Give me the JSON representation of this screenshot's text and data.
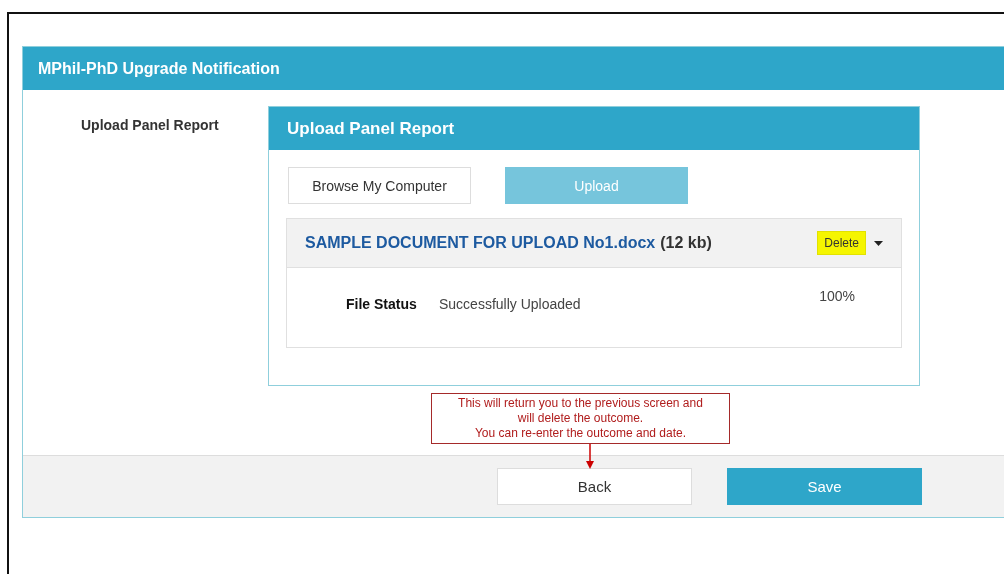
{
  "panel": {
    "title": "MPhil-PhD Upgrade Notification"
  },
  "field_label": "Upload Panel Report",
  "upload_card": {
    "title": "Upload Panel Report",
    "browse_button": "Browse My Computer",
    "upload_button": "Upload",
    "file": {
      "name": "SAMPLE DOCUMENT FOR UPLOAD No1.docx",
      "size": "(12 kb)",
      "delete_button": "Delete",
      "delete_highlighted": true,
      "status_label": "File Status",
      "status": "Successfully Uploaded",
      "percent": "100%"
    }
  },
  "annotation": {
    "lines": [
      "This will return you to the previous screen and",
      "will delete the outcome.",
      "You can re-enter the outcome and date."
    ]
  },
  "footer": {
    "buttons": [
      {
        "label": "Back",
        "kind": "secondary"
      },
      {
        "label": "Save",
        "kind": "primary"
      }
    ]
  }
}
